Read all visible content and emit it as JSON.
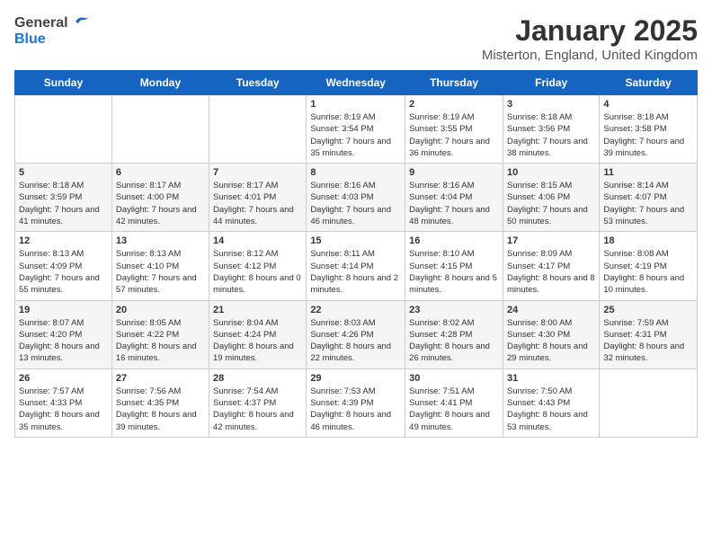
{
  "header": {
    "logo_general": "General",
    "logo_blue": "Blue",
    "month_title": "January 2025",
    "location": "Misterton, England, United Kingdom"
  },
  "days_of_week": [
    "Sunday",
    "Monday",
    "Tuesday",
    "Wednesday",
    "Thursday",
    "Friday",
    "Saturday"
  ],
  "weeks": [
    [
      {
        "day": "",
        "info": ""
      },
      {
        "day": "",
        "info": ""
      },
      {
        "day": "",
        "info": ""
      },
      {
        "day": "1",
        "info": "Sunrise: 8:19 AM\nSunset: 3:54 PM\nDaylight: 7 hours\nand 35 minutes."
      },
      {
        "day": "2",
        "info": "Sunrise: 8:19 AM\nSunset: 3:55 PM\nDaylight: 7 hours\nand 36 minutes."
      },
      {
        "day": "3",
        "info": "Sunrise: 8:18 AM\nSunset: 3:56 PM\nDaylight: 7 hours\nand 38 minutes."
      },
      {
        "day": "4",
        "info": "Sunrise: 8:18 AM\nSunset: 3:58 PM\nDaylight: 7 hours\nand 39 minutes."
      }
    ],
    [
      {
        "day": "5",
        "info": "Sunrise: 8:18 AM\nSunset: 3:59 PM\nDaylight: 7 hours\nand 41 minutes."
      },
      {
        "day": "6",
        "info": "Sunrise: 8:17 AM\nSunset: 4:00 PM\nDaylight: 7 hours\nand 42 minutes."
      },
      {
        "day": "7",
        "info": "Sunrise: 8:17 AM\nSunset: 4:01 PM\nDaylight: 7 hours\nand 44 minutes."
      },
      {
        "day": "8",
        "info": "Sunrise: 8:16 AM\nSunset: 4:03 PM\nDaylight: 7 hours\nand 46 minutes."
      },
      {
        "day": "9",
        "info": "Sunrise: 8:16 AM\nSunset: 4:04 PM\nDaylight: 7 hours\nand 48 minutes."
      },
      {
        "day": "10",
        "info": "Sunrise: 8:15 AM\nSunset: 4:06 PM\nDaylight: 7 hours\nand 50 minutes."
      },
      {
        "day": "11",
        "info": "Sunrise: 8:14 AM\nSunset: 4:07 PM\nDaylight: 7 hours\nand 53 minutes."
      }
    ],
    [
      {
        "day": "12",
        "info": "Sunrise: 8:13 AM\nSunset: 4:09 PM\nDaylight: 7 hours\nand 55 minutes."
      },
      {
        "day": "13",
        "info": "Sunrise: 8:13 AM\nSunset: 4:10 PM\nDaylight: 7 hours\nand 57 minutes."
      },
      {
        "day": "14",
        "info": "Sunrise: 8:12 AM\nSunset: 4:12 PM\nDaylight: 8 hours\nand 0 minutes."
      },
      {
        "day": "15",
        "info": "Sunrise: 8:11 AM\nSunset: 4:14 PM\nDaylight: 8 hours\nand 2 minutes."
      },
      {
        "day": "16",
        "info": "Sunrise: 8:10 AM\nSunset: 4:15 PM\nDaylight: 8 hours\nand 5 minutes."
      },
      {
        "day": "17",
        "info": "Sunrise: 8:09 AM\nSunset: 4:17 PM\nDaylight: 8 hours\nand 8 minutes."
      },
      {
        "day": "18",
        "info": "Sunrise: 8:08 AM\nSunset: 4:19 PM\nDaylight: 8 hours\nand 10 minutes."
      }
    ],
    [
      {
        "day": "19",
        "info": "Sunrise: 8:07 AM\nSunset: 4:20 PM\nDaylight: 8 hours\nand 13 minutes."
      },
      {
        "day": "20",
        "info": "Sunrise: 8:05 AM\nSunset: 4:22 PM\nDaylight: 8 hours\nand 16 minutes."
      },
      {
        "day": "21",
        "info": "Sunrise: 8:04 AM\nSunset: 4:24 PM\nDaylight: 8 hours\nand 19 minutes."
      },
      {
        "day": "22",
        "info": "Sunrise: 8:03 AM\nSunset: 4:26 PM\nDaylight: 8 hours\nand 22 minutes."
      },
      {
        "day": "23",
        "info": "Sunrise: 8:02 AM\nSunset: 4:28 PM\nDaylight: 8 hours\nand 26 minutes."
      },
      {
        "day": "24",
        "info": "Sunrise: 8:00 AM\nSunset: 4:30 PM\nDaylight: 8 hours\nand 29 minutes."
      },
      {
        "day": "25",
        "info": "Sunrise: 7:59 AM\nSunset: 4:31 PM\nDaylight: 8 hours\nand 32 minutes."
      }
    ],
    [
      {
        "day": "26",
        "info": "Sunrise: 7:57 AM\nSunset: 4:33 PM\nDaylight: 8 hours\nand 35 minutes."
      },
      {
        "day": "27",
        "info": "Sunrise: 7:56 AM\nSunset: 4:35 PM\nDaylight: 8 hours\nand 39 minutes."
      },
      {
        "day": "28",
        "info": "Sunrise: 7:54 AM\nSunset: 4:37 PM\nDaylight: 8 hours\nand 42 minutes."
      },
      {
        "day": "29",
        "info": "Sunrise: 7:53 AM\nSunset: 4:39 PM\nDaylight: 8 hours\nand 46 minutes."
      },
      {
        "day": "30",
        "info": "Sunrise: 7:51 AM\nSunset: 4:41 PM\nDaylight: 8 hours\nand 49 minutes."
      },
      {
        "day": "31",
        "info": "Sunrise: 7:50 AM\nSunset: 4:43 PM\nDaylight: 8 hours\nand 53 minutes."
      },
      {
        "day": "",
        "info": ""
      }
    ]
  ]
}
